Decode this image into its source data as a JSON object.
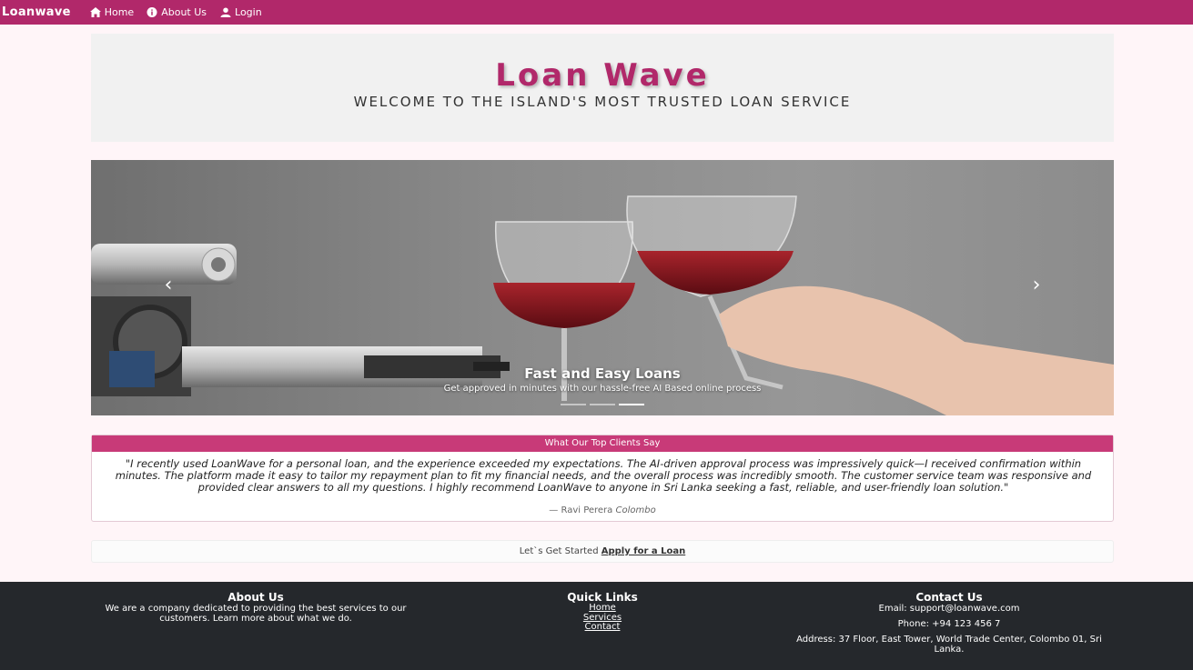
{
  "nav": {
    "brand": "Loanwave",
    "home": "Home",
    "about": "About Us",
    "login": "Login"
  },
  "hero": {
    "title": "Loan Wave",
    "subtitle": "WELCOME TO THE ISLAND'S MOST TRUSTED LOAN SERVICE"
  },
  "carousel": {
    "caption_title": "Fast and Easy Loans",
    "caption_text": "Get approved in minutes with our hassle-free AI Based online process",
    "prev_icon": "chevron-left-icon",
    "next_icon": "chevron-right-icon",
    "slides": 3,
    "active_slide": 3
  },
  "testimonial": {
    "header": "What Our Top Clients Say",
    "quote": "\"I recently used LoanWave for a personal loan, and the experience exceeded my expectations. The AI-driven approval process was impressively quick—I received confirmation within minutes. The platform made it easy to tailor my repayment plan to fit my financial needs, and the overall process was incredibly smooth. The customer service team was responsive and provided clear answers to all my questions. I highly recommend LoanWave to anyone in Sri Lanka seeking a fast, reliable, and user-friendly loan solution.\"",
    "author": "— Ravi Perera",
    "city": "Colombo"
  },
  "cta": {
    "text": "Let`s Get Started",
    "link": "Apply for a Loan"
  },
  "footer": {
    "about_title": "About Us",
    "about_text": "We are a company dedicated to providing the best services to our customers. Learn more about what we do.",
    "links_title": "Quick Links",
    "links": [
      "Home",
      "Services",
      "Contact"
    ],
    "contact_title": "Contact Us",
    "email": "Email: support@loanwave.com",
    "phone": "Phone: +94 123 456 7",
    "address": "Address: 37 Floor, East Tower, World Trade Center, Colombo 01, Sri Lanka."
  },
  "colors": {
    "brand": "#b1286a",
    "testimonial_header": "#c83a78",
    "footer_bg": "#25282c",
    "page_bg": "#fff5f8"
  }
}
